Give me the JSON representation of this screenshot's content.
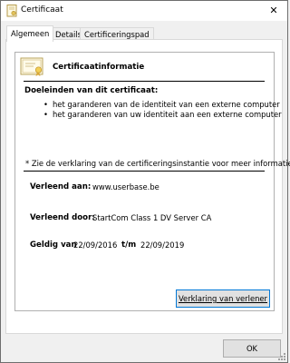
{
  "window": {
    "title": "Certificaat",
    "close": "✕"
  },
  "tabs": [
    {
      "label": "Algemeen",
      "active": true
    },
    {
      "label": "Details",
      "active": false
    },
    {
      "label": "Certificeringspad",
      "active": false
    }
  ],
  "info": {
    "heading": "Certificaatinformatie",
    "purposes_title": "Doeleinden van dit certificaat:",
    "purposes": [
      "het garanderen van de identiteit van een externe computer",
      "het garanderen van uw identiteit aan een externe computer"
    ],
    "note": "* Zie de verklaring van de certificeringsinstantie voor meer informatie."
  },
  "fields": {
    "issued_to_label": "Verleend aan:",
    "issued_to_value": "www.userbase.be",
    "issued_by_label": "Verleend door:",
    "issued_by_value": "StartCom Class 1 DV Server CA",
    "valid_from_label": "Geldig van",
    "valid_from_value": "22/09/2016",
    "valid_to_label": "t/m",
    "valid_to_value": "22/09/2019"
  },
  "buttons": {
    "issuer_statement": "Verklaring van verlener",
    "ok": "OK"
  },
  "icons": {
    "title": "certificate-icon",
    "cert": "certificate-icon"
  }
}
